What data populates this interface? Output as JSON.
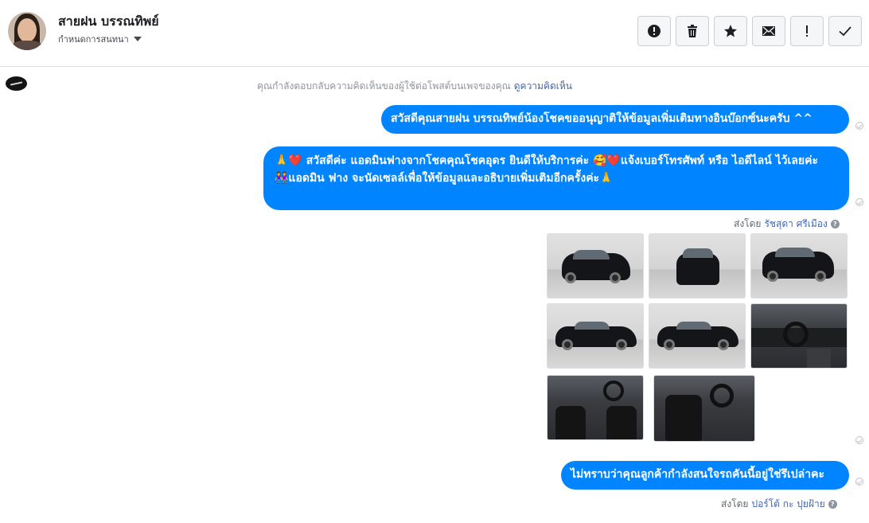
{
  "header": {
    "contact_name": "สายฝน บรรณทิพย์",
    "conversation_label": "กำหนดการสนทนา",
    "tools": [
      {
        "icon": "alert-circle-icon",
        "name": "report-button"
      },
      {
        "icon": "trash-icon",
        "name": "delete-button"
      },
      {
        "icon": "star-icon",
        "name": "star-button"
      },
      {
        "icon": "envelope-icon",
        "name": "mark-unread-button"
      },
      {
        "icon": "exclamation-icon",
        "name": "follow-up-button"
      },
      {
        "icon": "check-icon",
        "name": "mark-done-button"
      }
    ]
  },
  "notice": {
    "text": "คุณกำลังตอบกลับความคิดเห็นของผู้ใช้ต่อโพสต์บนเพจของคุณ",
    "link": "ดูความคิดเห็น"
  },
  "messages": [
    {
      "text": "สวัสดีคุณสายฝน บรรณทิพย์น้องโชคขออนุญาติให้ข้อมูลเพิ่มเติมทางอินบ๊อกซ์นะครับ ^^"
    },
    {
      "lines": [
        "🙏❤️ สวัสดีค่ะ แอดมินฟางจากโชคคุณโชคอุดร ยินดีให้บริการค่ะ 🥰❤️แจ้งเบอร์โทรศัพท์ หรือ ไอดีไลน์ ไว้เลยค่ะ",
        "👭แอดมิน ฟาง จะนัดเซลล์เพื่อให้ข้อมูลและอธิบายเพิ่มเติมอีกครั้งค่ะ🙏"
      ]
    },
    {
      "text": "ไม่ทราบว่าคุณลูกค้ากำลังสนใจรถคันนี้อยู่ใช่รึเปล่าคะ"
    }
  ],
  "sent_by": [
    {
      "prefix": "ส่งโดย",
      "sender": "รัชสุดา ศรีเมือง"
    },
    {
      "prefix": "ส่งโดย",
      "sender": "ปอร์โต้ กะ ปุยฝ้าย"
    }
  ],
  "attachments": {
    "photos": [
      "car-front-left",
      "car-front",
      "car-rear-right",
      "car-side-left",
      "car-side-left-2",
      "car-dashboard",
      "car-front-seats",
      "car-driver-seat"
    ]
  },
  "colors": {
    "bubble": "#0084ff",
    "link": "#4267b2"
  }
}
